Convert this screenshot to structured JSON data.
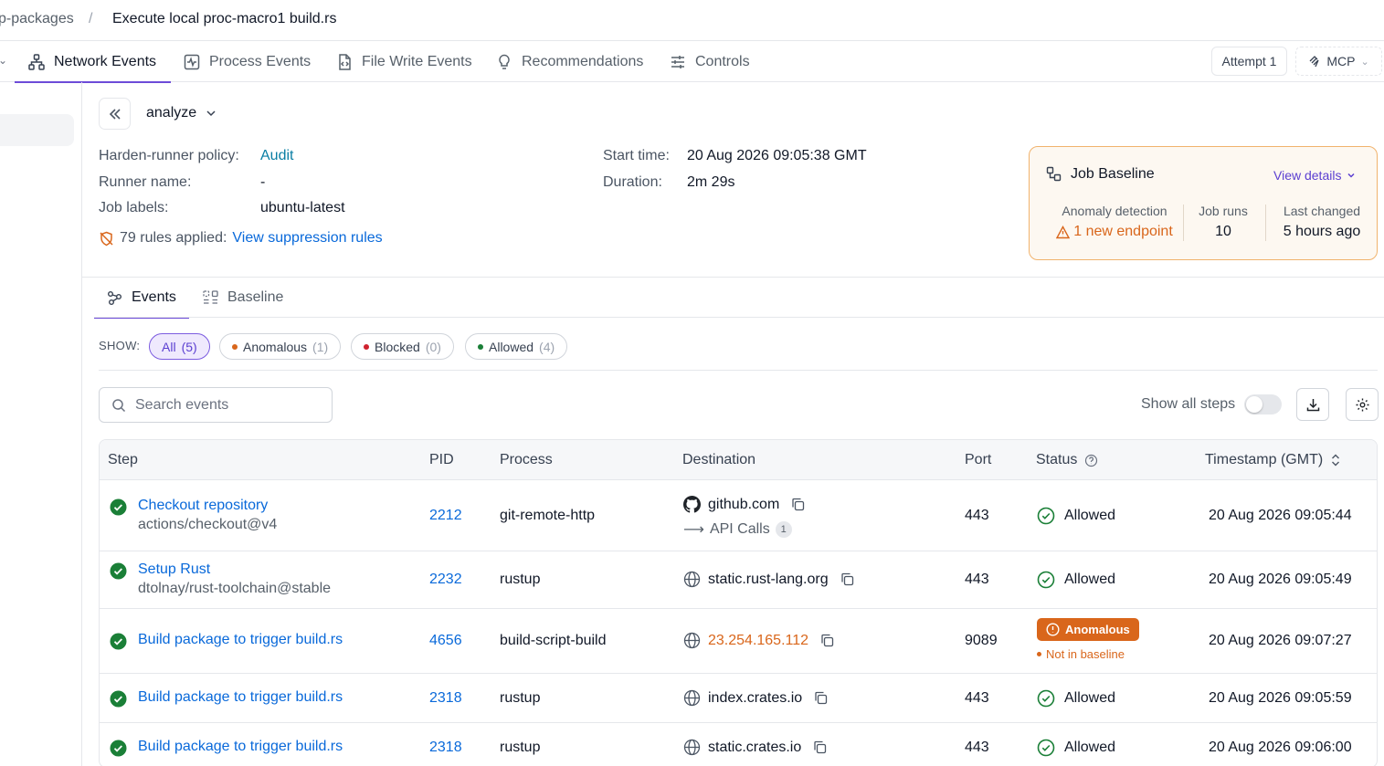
{
  "breadcrumb": {
    "previous": "p-packages",
    "separator": "/",
    "current": "Execute local proc-macro1 build.rs"
  },
  "tabs": [
    {
      "label": "Network Events",
      "icon": "network-icon"
    },
    {
      "label": "Process Events",
      "icon": "activity-icon"
    },
    {
      "label": "File Write Events",
      "icon": "file-code-icon"
    },
    {
      "label": "Recommendations",
      "icon": "lightbulb-icon"
    },
    {
      "label": "Controls",
      "icon": "sliders-icon"
    }
  ],
  "header_buttons": {
    "attempt": "Attempt 1",
    "mcp": "MCP"
  },
  "job": {
    "name": "analyze"
  },
  "details": {
    "policy_label": "Harden-runner policy:",
    "policy_value": "Audit",
    "runner_label": "Runner name:",
    "runner_value": "-",
    "labels_label": "Job labels:",
    "labels_value": "ubuntu-latest",
    "rules_text": "79 rules applied:",
    "rules_link": "View suppression rules",
    "start_label": "Start time:",
    "start_value": "20 Aug 2026 09:05:38 GMT",
    "duration_label": "Duration:",
    "duration_value": "2m 29s"
  },
  "baseline": {
    "title": "Job Baseline",
    "view_details": "View details",
    "anomaly_label": "Anomaly detection",
    "anomaly_value": "1 new endpoint",
    "runs_label": "Job runs",
    "runs_value": "10",
    "changed_label": "Last changed",
    "changed_value": "5 hours ago"
  },
  "subtabs": [
    {
      "label": "Events"
    },
    {
      "label": "Baseline"
    }
  ],
  "filters": {
    "show_label": "SHOW:",
    "chips": [
      {
        "label": "All",
        "count": "(5)"
      },
      {
        "label": "Anomalous",
        "count": "(1)"
      },
      {
        "label": "Blocked",
        "count": "(0)"
      },
      {
        "label": "Allowed",
        "count": "(4)"
      }
    ]
  },
  "search": {
    "placeholder": "Search events"
  },
  "show_all_steps": "Show all steps",
  "table": {
    "headers": {
      "step": "Step",
      "pid": "PID",
      "process": "Process",
      "destination": "Destination",
      "port": "Port",
      "status": "Status",
      "timestamp": "Timestamp (GMT)"
    },
    "rows": [
      {
        "step": "Checkout repository",
        "sub": "actions/checkout@v4",
        "pid": "2212",
        "process": "git-remote-http",
        "destination": "github.com",
        "api_calls": "API Calls",
        "api_count": "1",
        "port": "443",
        "status": "Allowed",
        "timestamp": "20 Aug 2026 09:05:44"
      },
      {
        "step": "Setup Rust",
        "sub": "dtolnay/rust-toolchain@stable",
        "pid": "2232",
        "process": "rustup",
        "destination": "static.rust-lang.org",
        "port": "443",
        "status": "Allowed",
        "timestamp": "20 Aug 2026 09:05:49"
      },
      {
        "step": "Build package to trigger build.rs",
        "pid": "4656",
        "process": "build-script-build",
        "destination": "23.254.165.112",
        "port": "9089",
        "status": "Anomalous",
        "status_note": "Not in baseline",
        "timestamp": "20 Aug 2026 09:07:27"
      },
      {
        "step": "Build package to trigger build.rs",
        "pid": "2318",
        "process": "rustup",
        "destination": "index.crates.io",
        "port": "443",
        "status": "Allowed",
        "timestamp": "20 Aug 2026 09:05:59"
      },
      {
        "step": "Build package to trigger build.rs",
        "pid": "2318",
        "process": "rustup",
        "destination": "static.crates.io",
        "port": "443",
        "status": "Allowed",
        "timestamp": "20 Aug 2026 09:06:00"
      }
    ]
  },
  "colors": {
    "accent": "#6d4bd8",
    "link": "#0969da",
    "success": "#1a7f37",
    "anomaly": "#d9661b",
    "blocked": "#cf222e"
  }
}
